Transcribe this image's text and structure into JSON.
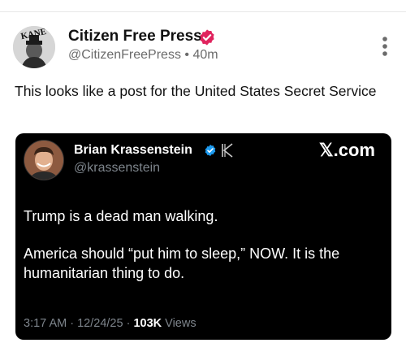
{
  "post": {
    "author_name": "Citizen Free Press",
    "handle": "@CitizenFreePress",
    "separator": "•",
    "time_ago": "40m",
    "avatar_logo_text": "KANE",
    "text": "This looks like a post for the United States Secret Service",
    "verified_color": "#e0245e"
  },
  "embedded_post": {
    "author_name": "Brian Krassenstein",
    "handle": "@krassenstein",
    "source_label": "𝕏.com",
    "paragraphs": [
      "Trump is a dead man walking.",
      "America should “put him to sleep,” NOW.  It is the humanitarian thing to do."
    ],
    "time": "3:17 AM",
    "date": "12/24/25",
    "dot": "·",
    "views_count": "103K",
    "views_label": "Views",
    "verified_color": "#1d9bf0"
  },
  "icons": {
    "more": "vertical-dots-icon",
    "verified": "verified-badge-icon",
    "k_logo": "k-logo-icon"
  }
}
